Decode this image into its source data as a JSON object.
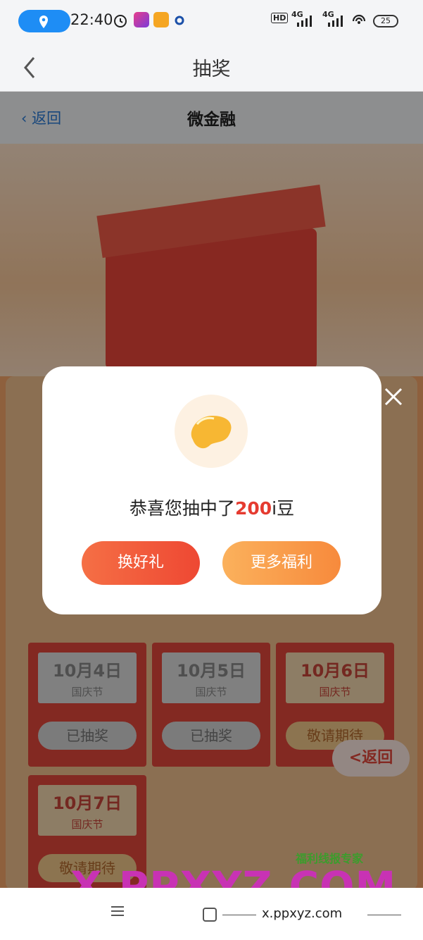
{
  "status_bar": {
    "time": "22:40",
    "net1": "4G",
    "net2": "4G",
    "hd": "HD",
    "battery": "25"
  },
  "header": {
    "title": "抽奖",
    "back_icon": "chevron-left-icon"
  },
  "subpage": {
    "back_label": "返回",
    "title": "微金融"
  },
  "tickets": [
    {
      "date": "10月4日",
      "festival": "国庆节",
      "button": "已抽奖",
      "state": "done"
    },
    {
      "date": "10月5日",
      "festival": "国庆节",
      "button": "已抽奖",
      "state": "done"
    },
    {
      "date": "10月6日",
      "festival": "国庆节",
      "button": "敬请期待",
      "state": "pending"
    },
    {
      "date": "10月7日",
      "festival": "国庆节",
      "button": "敬请期待",
      "state": "pending"
    }
  ],
  "float_back": "<返回",
  "modal": {
    "message_prefix": "恭喜您抽中了",
    "amount": "200",
    "message_suffix": "i豆",
    "btn_gift": "换好礼",
    "btn_more": "更多福利"
  },
  "watermark": {
    "small": "福利线报专家",
    "big": "X.PPXYZ.COM",
    "url": "x.ppxyz.com"
  },
  "colors": {
    "accent_red": "#e53b30",
    "btn_red": "#ee4833",
    "btn_orange": "#f78a3c",
    "status_pill": "#1e8df5"
  }
}
